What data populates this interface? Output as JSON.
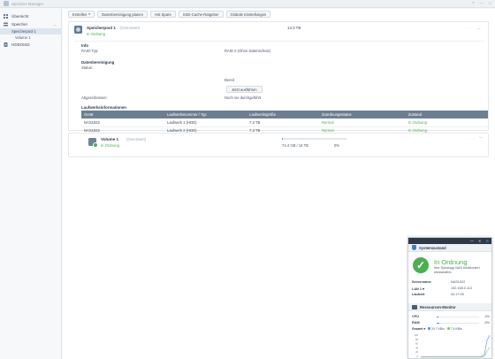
{
  "window": {
    "title": "Speicher-Manager",
    "buttons": [
      "?",
      "—",
      "□"
    ]
  },
  "sidebar": {
    "items": [
      {
        "label": "Übersicht"
      },
      {
        "label": "Speicher"
      },
      {
        "label": "HDD/SSD"
      }
    ],
    "pool_label": "Speicherpool 1",
    "volume_label": "Volume 1"
  },
  "toolbar": {
    "create_label": "Erstellen",
    "scrub_label": "Datenbereinigung planen",
    "hotspare_label": "Hot Spare",
    "ssd_label": "SSD-Cache-Ratgeber",
    "settings_label": "Globale Einstellungen"
  },
  "pool": {
    "title": "Speicherpool 1",
    "subtitle": "(Grenzwert)",
    "status": "In Ordnung",
    "size": "14.3 TB",
    "info_title": "Info",
    "raid_label": "RAID-Typ:",
    "raid_value": "RAID 0 (Ohne Datenschutz)",
    "scrub_title": "Datenbereinigung",
    "state_label": "Status:",
    "state_value": "Bereit",
    "run_now": "Jetzt ausführen",
    "done_label": "Abgeschlossen:",
    "done_value": "Noch nie durchgeführt",
    "drives_title": "Laufwerksinformationen",
    "columns": [
      "Gerät",
      "Laufwerksnummer / Typ",
      "Laufwerksgröße",
      "Zuordnungsstatus",
      "Zustand"
    ],
    "drives": [
      [
        "NAS1522",
        "Laufwerk 1 (HDD)",
        "7.3 TB",
        "Normal",
        "In Ordnung"
      ],
      [
        "NAS1522",
        "Laufwerk 2 (HDD)",
        "7.3 TB",
        "Normal",
        "In Ordnung"
      ]
    ]
  },
  "volume": {
    "title": "Volume 1",
    "subtitle": "(Grenzwert)",
    "status": "In Ordnung",
    "used": "74.4 GB / 14 TB",
    "percent": "0%",
    "fill": 0.005
  },
  "widget": {
    "health_title": "Systemzustand",
    "health_status": "In Ordnung",
    "health_desc": "Ihre Synology NAS funktioniert einwandfrei.",
    "server_label": "Servername",
    "server_value": "NAS1522",
    "lan_label": "LAN 1",
    "lan_value": "192.168.0.113",
    "uptime_label": "Laufzeit",
    "uptime_value": "00:17:05",
    "resource_title": "Ressourcen-Monitor",
    "cpu_label": "CPU",
    "cpu_value": "4%",
    "cpu_fill": 0.04,
    "ram_label": "RAM",
    "ram_value": "6%",
    "ram_fill": 0.06,
    "lan_select": "Gesamt",
    "upload": "20.7 KB/s",
    "download": "7.6 KB/s",
    "chart_ticks": [
      "100",
      "80",
      "60",
      "40",
      "20",
      "0"
    ],
    "colors": {
      "upload": "#4c8fd0",
      "download": "#7dc26b"
    }
  }
}
